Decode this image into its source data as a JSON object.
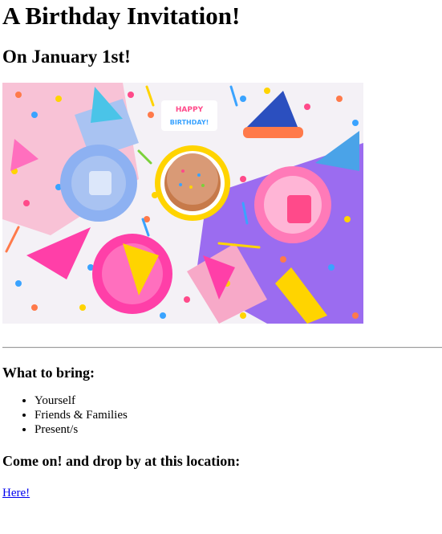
{
  "page": {
    "title": "A Birthday Invitation!",
    "date_heading": "On January 1st!",
    "photo_banner_text": "HAPPY BIRTHDAY!",
    "bring_heading": "What to bring:",
    "bring_items": [
      "Yourself",
      "Friends & Families",
      "Present/s"
    ],
    "location_heading": "Come on! and drop by at this location:",
    "location_link": "Here!"
  },
  "colors": {
    "link": "#0000ee",
    "photo_background": "#f4f1f6",
    "purple_paper": "#9b6cf0",
    "pink_paper": "#f7b6cf"
  }
}
